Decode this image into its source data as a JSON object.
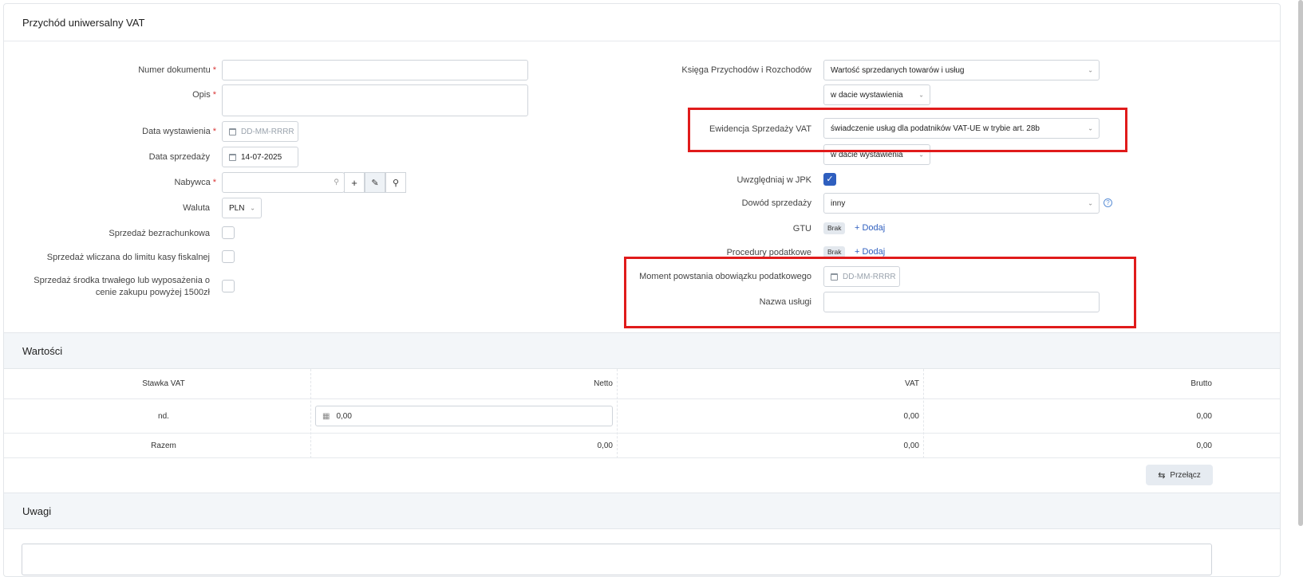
{
  "header": {
    "title": "Przychód uniwersalny VAT"
  },
  "left": {
    "doc_number_label": "Numer dokumentu",
    "desc_label": "Opis",
    "issue_date_label": "Data wystawienia",
    "issue_date_placeholder": "DD-MM-RRRR",
    "sale_date_label": "Data sprzedaży",
    "sale_date_value": "14-07-2025",
    "buyer_label": "Nabywca",
    "currency_label": "Waluta",
    "currency_value": "PLN",
    "cashless_label": "Sprzedaż bezrachunkowa",
    "fiscal_label": "Sprzedaż wliczana do limitu kasy fiskalnej",
    "fixed_asset_label_1": "Sprzedaż środka trwałego lub wyposażenia o",
    "fixed_asset_label_2": "cenie zakupu powyżej 1500zł",
    "required_mark": "*"
  },
  "right": {
    "kpir_label": "Księga Przychodów i Rozchodów",
    "kpir_value": "Wartość sprzedanych towarów i usług",
    "kpir_date_value": "w dacie wystawienia",
    "vat_reg_label": "Ewidencja Sprzedaży VAT",
    "vat_reg_value": "świadczenie usług dla podatników VAT-UE w trybie art. 28b",
    "vat_reg_date_value": "w dacie wystawienia",
    "jpk_label": "Uwzględniaj w JPK",
    "proof_label": "Dowód sprzedaży",
    "proof_value": "inny",
    "gtu_label": "GTU",
    "gtu_badge": "Brak",
    "gtu_add": "+ Dodaj",
    "proc_label": "Procedury podatkowe",
    "proc_badge": "Brak",
    "proc_add": "+ Dodaj",
    "tax_moment_label": "Moment powstania obowiązku podatkowego",
    "tax_moment_placeholder": "DD-MM-RRRR",
    "service_name_label": "Nazwa usługi"
  },
  "values_section": {
    "title": "Wartości",
    "columns": [
      "Stawka VAT",
      "Netto",
      "VAT",
      "Brutto"
    ],
    "row": {
      "rate": "nd.",
      "net": "0,00",
      "vat": "0,00",
      "gross": "0,00"
    },
    "total": {
      "label": "Razem",
      "net": "0,00",
      "vat": "0,00",
      "gross": "0,00"
    },
    "switch_button": "Przełącz"
  },
  "notes_section": {
    "title": "Uwagi"
  }
}
